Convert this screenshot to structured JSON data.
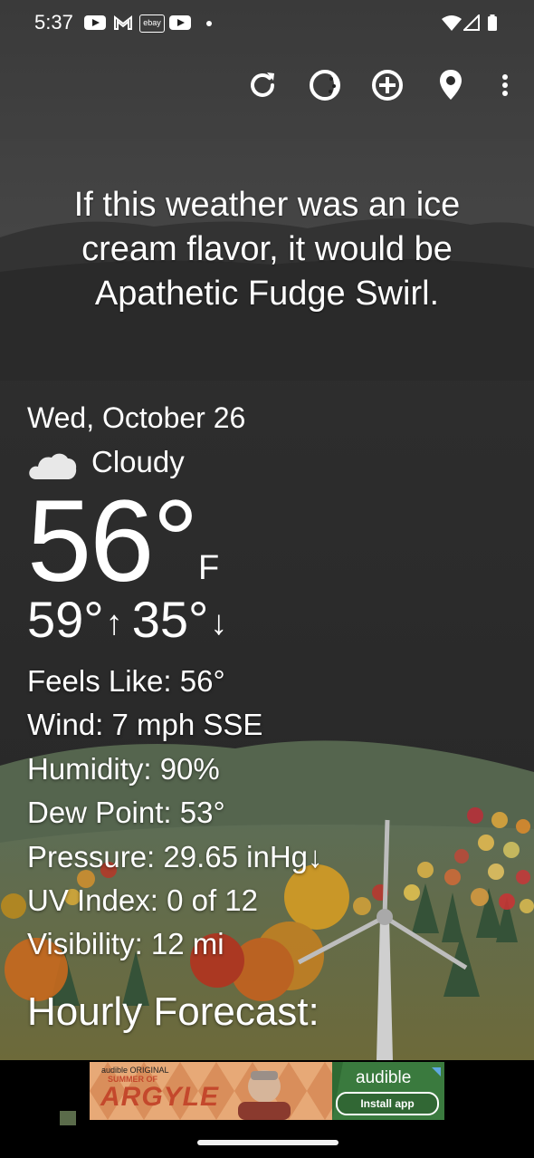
{
  "status_bar": {
    "time": "5:37",
    "notification_icons": [
      "youtube-icon",
      "gmail-icon",
      "ebay-icon",
      "youtube-icon",
      "dot-icon"
    ],
    "ebay_label": "ebay",
    "system_icons": [
      "wifi-icon",
      "cell-signal-icon",
      "battery-icon"
    ]
  },
  "toolbar": {
    "actions": [
      "refresh-icon",
      "theme-icon",
      "add-location-icon",
      "location-pin-icon",
      "more-options-icon"
    ]
  },
  "quote": {
    "line1": "If this weather was an ice",
    "line2": "cream flavor, it would be",
    "line3": "Apathetic Fudge Swirl."
  },
  "current": {
    "date": "Wed, October 26",
    "condition": "Cloudy",
    "condition_icon": "cloud-icon",
    "temperature": "56°",
    "unit": "F",
    "high": "59°",
    "high_arrow": "↑",
    "low": "35°",
    "low_arrow": "↓"
  },
  "details": {
    "feels_like": "Feels Like:  56°",
    "wind": "Wind:  7 mph SSE",
    "humidity": "Humidity:  90%",
    "dew_point": "Dew Point:  53°",
    "pressure": "Pressure:  29.65 inHg↓",
    "uv_index": "UV Index:  0 of 12",
    "visibility": "Visibility:  12 mi"
  },
  "hourly": {
    "heading": "Hourly Forecast:"
  },
  "ad": {
    "tagline": "audible ORIGINAL",
    "title_line1": "SUMMER OF",
    "title_line2": "ARGYLE",
    "brand": "audible",
    "cta": "Install app"
  },
  "colors": {
    "sky": "#2b2b2b",
    "fog": "#4a4a4a",
    "hill": "#4d5a3f",
    "ground": "#6b6a3a",
    "ad_green": "#3a7a3e"
  }
}
